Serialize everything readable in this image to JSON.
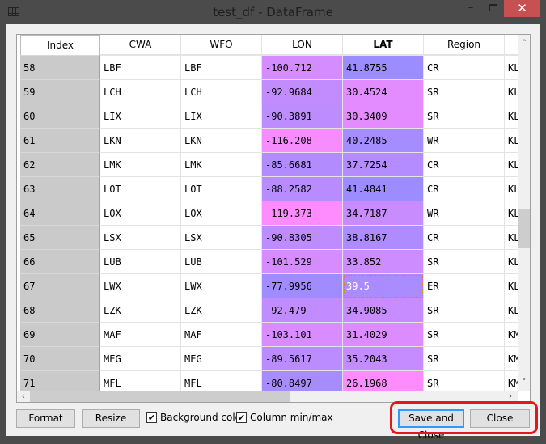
{
  "window": {
    "title": "test_df - DataFrame",
    "minimize": "–",
    "close": "✕"
  },
  "table": {
    "columns": [
      "Index",
      "CWA",
      "WFO",
      "LON",
      "LAT",
      "Region",
      ""
    ],
    "sorted_column": "LAT",
    "rows": [
      {
        "index": "58",
        "cwa": "LBF",
        "wfo": "LBF",
        "lon": "-100.712",
        "lat": "41.8755",
        "region": "CR",
        "extra": "KL"
      },
      {
        "index": "59",
        "cwa": "LCH",
        "wfo": "LCH",
        "lon": "-92.9684",
        "lat": "30.4524",
        "region": "SR",
        "extra": "KL"
      },
      {
        "index": "60",
        "cwa": "LIX",
        "wfo": "LIX",
        "lon": "-90.3891",
        "lat": "30.3409",
        "region": "SR",
        "extra": "KL"
      },
      {
        "index": "61",
        "cwa": "LKN",
        "wfo": "LKN",
        "lon": "-116.208",
        "lat": "40.2485",
        "region": "WR",
        "extra": "KL"
      },
      {
        "index": "62",
        "cwa": "LMK",
        "wfo": "LMK",
        "lon": "-85.6681",
        "lat": "37.7254",
        "region": "CR",
        "extra": "KL"
      },
      {
        "index": "63",
        "cwa": "LOT",
        "wfo": "LOT",
        "lon": "-88.2582",
        "lat": "41.4841",
        "region": "CR",
        "extra": "KL"
      },
      {
        "index": "64",
        "cwa": "LOX",
        "wfo": "LOX",
        "lon": "-119.373",
        "lat": "34.7187",
        "region": "WR",
        "extra": "KL"
      },
      {
        "index": "65",
        "cwa": "LSX",
        "wfo": "LSX",
        "lon": "-90.8305",
        "lat": "38.8167",
        "region": "CR",
        "extra": "KL"
      },
      {
        "index": "66",
        "cwa": "LUB",
        "wfo": "LUB",
        "lon": "-101.529",
        "lat": "33.852",
        "region": "SR",
        "extra": "KL"
      },
      {
        "index": "67",
        "cwa": "LWX",
        "wfo": "LWX",
        "lon": "-77.9956",
        "lat": "39.5",
        "region": "ER",
        "extra": "KL"
      },
      {
        "index": "68",
        "cwa": "LZK",
        "wfo": "LZK",
        "lon": "-92.479",
        "lat": "34.9085",
        "region": "SR",
        "extra": "KL"
      },
      {
        "index": "69",
        "cwa": "MAF",
        "wfo": "MAF",
        "lon": "-103.101",
        "lat": "31.4029",
        "region": "SR",
        "extra": "KM"
      },
      {
        "index": "70",
        "cwa": "MEG",
        "wfo": "MEG",
        "lon": "-89.5617",
        "lat": "35.2043",
        "region": "SR",
        "extra": "KM"
      },
      {
        "index": "71",
        "cwa": "MFL",
        "wfo": "MFL",
        "lon": "-80.8497",
        "lat": "26.1968",
        "region": "SR",
        "extra": "KM"
      }
    ],
    "selected_row": "67",
    "selected_column": "LAT",
    "colors": {
      "low": "#ff8cff",
      "high": "#9a8cff",
      "selected": "#3399ff",
      "index_bg": "#cacaca"
    }
  },
  "footer": {
    "format": "Format",
    "resize": "Resize",
    "background_color": {
      "label": "Background color",
      "checked": true
    },
    "column_minmax": {
      "label": "Column min/max",
      "checked": true
    },
    "save_close": "Save and Close",
    "close": "Close",
    "highlight_color": "#e4161e"
  }
}
